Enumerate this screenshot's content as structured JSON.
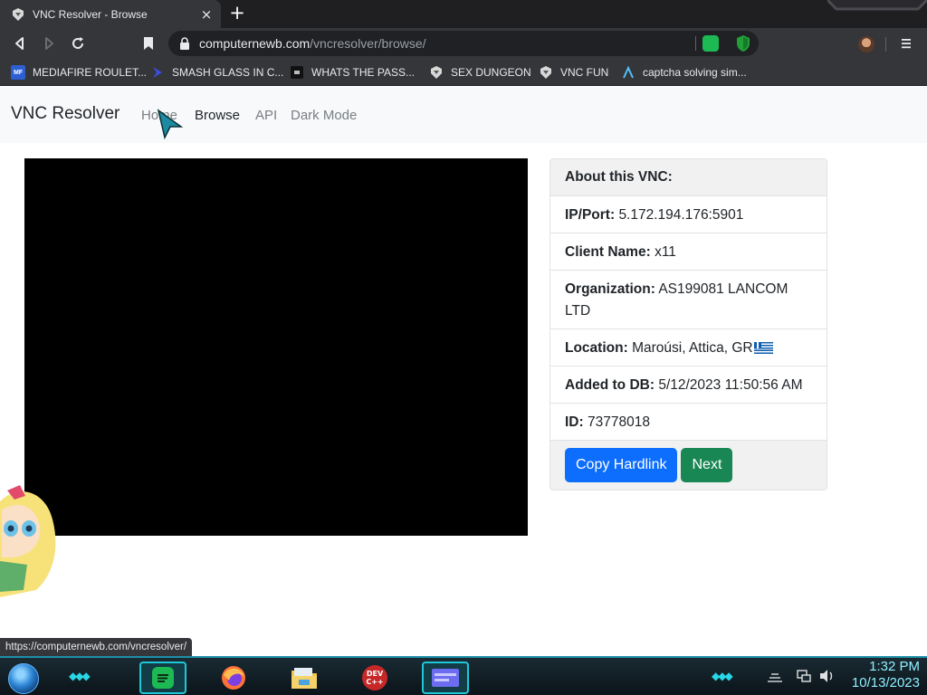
{
  "browser": {
    "tab_title": "VNC Resolver - Browse",
    "tab_close": "×",
    "new_tab": "+",
    "url_domain": "computernewb.com",
    "url_path": "/vncresolver/browse/",
    "bookmarks": [
      {
        "label": "MEDIAFIRE ROULET...",
        "icon": "mediafire-icon"
      },
      {
        "label": "SMASH GLASS IN C...",
        "icon": "chevron-icon"
      },
      {
        "label": "WHATS THE PASS...",
        "icon": "terminal-icon"
      },
      {
        "label": "SEX DUNGEON",
        "icon": "vnc-icon"
      },
      {
        "label": "VNC FUN",
        "icon": "vnc-icon"
      },
      {
        "label": "captcha solving sim...",
        "icon": "lambda-icon"
      }
    ],
    "status_url": "https://computernewb.com/vncresolver/"
  },
  "page": {
    "brand": "VNC Resolver",
    "nav": [
      "Home",
      "Browse",
      "API",
      "Dark Mode"
    ]
  },
  "vnc": {
    "header": "About this VNC:",
    "ip_label": "IP/Port:",
    "ip_value": "5.172.194.176:5901",
    "client_label": "Client Name:",
    "client_value": "x11",
    "org_label": "Organization:",
    "org_value": "AS199081 LANCOM LTD",
    "location_label": "Location:",
    "location_value": "Maroúsi, Attica, GR",
    "added_label": "Added to DB:",
    "added_value": "5/12/2023 11:50:56 AM",
    "id_label": "ID:",
    "id_value": "73778018",
    "copy_button": "Copy Hardlink",
    "next_button": "Next",
    "colors": {
      "primary": "#0d6efd",
      "success": "#198754"
    }
  },
  "taskbar": {
    "time": "1:32 PM",
    "date": "10/13/2023",
    "apps": [
      "spotify-icon",
      "firefox-icon",
      "file-explorer-icon",
      "devcpp-icon",
      "window-icon"
    ]
  }
}
